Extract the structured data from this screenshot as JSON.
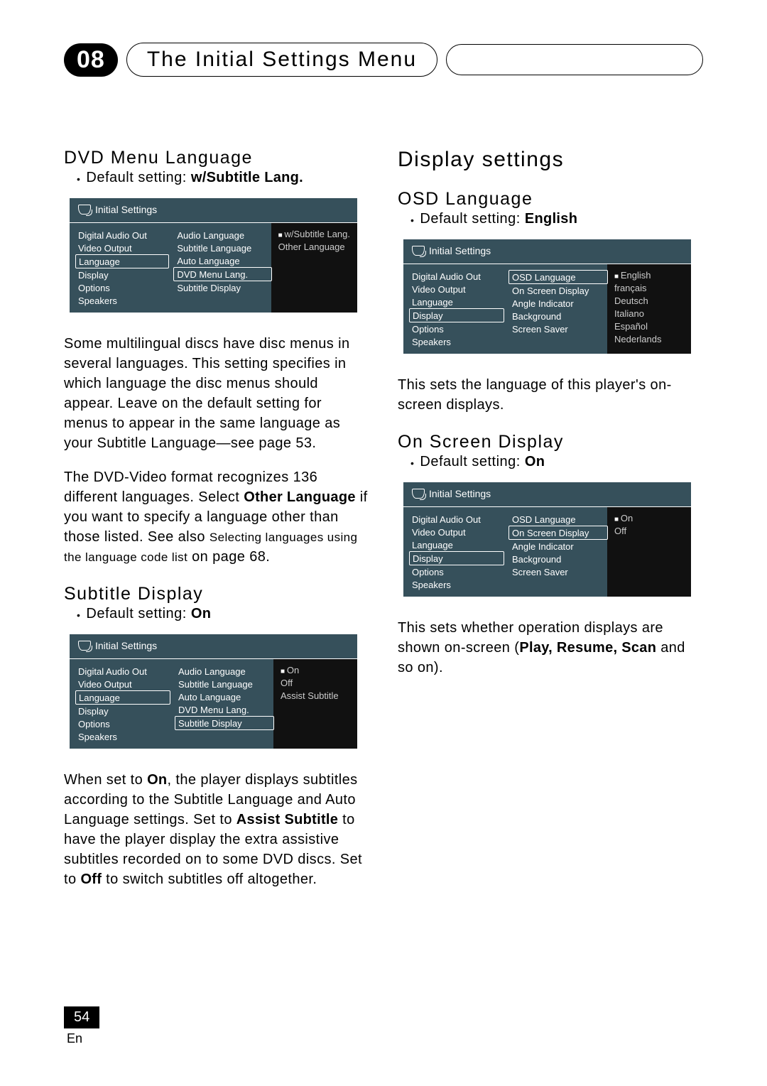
{
  "header": {
    "chapter_number": "08",
    "chapter_title": "The Initial Settings Menu"
  },
  "left_column": {
    "dvd_menu_language": {
      "title": "DVD Menu Language",
      "default_label": "Default setting:",
      "default_value": "w/Subtitle Lang.",
      "menu": {
        "title": "Initial Settings",
        "left_items": [
          "Digital Audio Out",
          "Video Output",
          "Language",
          "Display",
          "Options",
          "Speakers"
        ],
        "left_selected_index": 2,
        "mid_items": [
          "Audio Language",
          "Subtitle Language",
          "Auto Language",
          "DVD Menu Lang.",
          "Subtitle Display"
        ],
        "mid_selected_index": 3,
        "right_items": [
          "w/Subtitle Lang.",
          "Other Language"
        ],
        "right_marked_index": 0
      },
      "paragraph_1": "Some multilingual discs have disc menus in several languages. This setting specifies in which language the disc menus should appear. Leave on the default setting for menus to appear in the same language as your Subtitle Language—see page 53.",
      "paragraph_2_a": "The DVD-Video format recognizes 136 different languages. Select ",
      "paragraph_2_bold": "Other Language",
      "paragraph_2_b": " if you want to specify a language other than those listed. See also ",
      "paragraph_2_sub": "Selecting languages using the language code list",
      "paragraph_2_c": " on page 68."
    },
    "subtitle_display": {
      "title": "Subtitle Display",
      "default_label": "Default setting:",
      "default_value": "On",
      "menu": {
        "title": "Initial Settings",
        "left_items": [
          "Digital Audio Out",
          "Video Output",
          "Language",
          "Display",
          "Options",
          "Speakers"
        ],
        "left_selected_index": 2,
        "mid_items": [
          "Audio Language",
          "Subtitle Language",
          "Auto Language",
          "DVD Menu Lang.",
          "Subtitle Display"
        ],
        "mid_selected_index": 4,
        "right_items": [
          "On",
          "Off",
          "Assist Subtitle"
        ],
        "right_marked_index": 0
      },
      "paragraph_a": "When set to ",
      "paragraph_bold1": "On",
      "paragraph_b": ", the player displays subtitles according to the Subtitle Language and Auto Language settings. Set to ",
      "paragraph_bold2": "Assist Subtitle",
      "paragraph_c": " to have the player display the extra assistive subtitles recorded on to some DVD discs. Set to ",
      "paragraph_bold3": "Off",
      "paragraph_d": " to switch subtitles off altogether."
    }
  },
  "right_column": {
    "display_settings_title": "Display settings",
    "osd_language": {
      "title": "OSD Language",
      "default_label": "Default setting:",
      "default_value": "English",
      "menu": {
        "title": "Initial Settings",
        "left_items": [
          "Digital Audio Out",
          "Video Output",
          "Language",
          "Display",
          "Options",
          "Speakers"
        ],
        "left_selected_index": 3,
        "mid_items": [
          "OSD Language",
          "On Screen Display",
          "Angle Indicator",
          "Background",
          "Screen Saver"
        ],
        "mid_selected_index": 0,
        "right_items": [
          "English",
          "français",
          "Deutsch",
          "Italiano",
          "Español",
          "Nederlands"
        ],
        "right_marked_index": 0
      },
      "paragraph": "This sets the language of this player's on-screen displays."
    },
    "on_screen_display": {
      "title": "On Screen Display",
      "default_label": "Default setting:",
      "default_value": "On",
      "menu": {
        "title": "Initial Settings",
        "left_items": [
          "Digital Audio Out",
          "Video Output",
          "Language",
          "Display",
          "Options",
          "Speakers"
        ],
        "left_selected_index": 3,
        "mid_items": [
          "OSD Language",
          "On Screen Display",
          "Angle Indicator",
          "Background",
          "Screen Saver"
        ],
        "mid_selected_index": 1,
        "right_items": [
          "On",
          "Off"
        ],
        "right_marked_index": 0
      },
      "paragraph_a": "This sets whether operation displays are shown on-screen (",
      "paragraph_bold": "Play, Resume, Scan",
      "paragraph_b": " and so on)."
    }
  },
  "footer": {
    "page_number": "54",
    "lang": "En"
  }
}
